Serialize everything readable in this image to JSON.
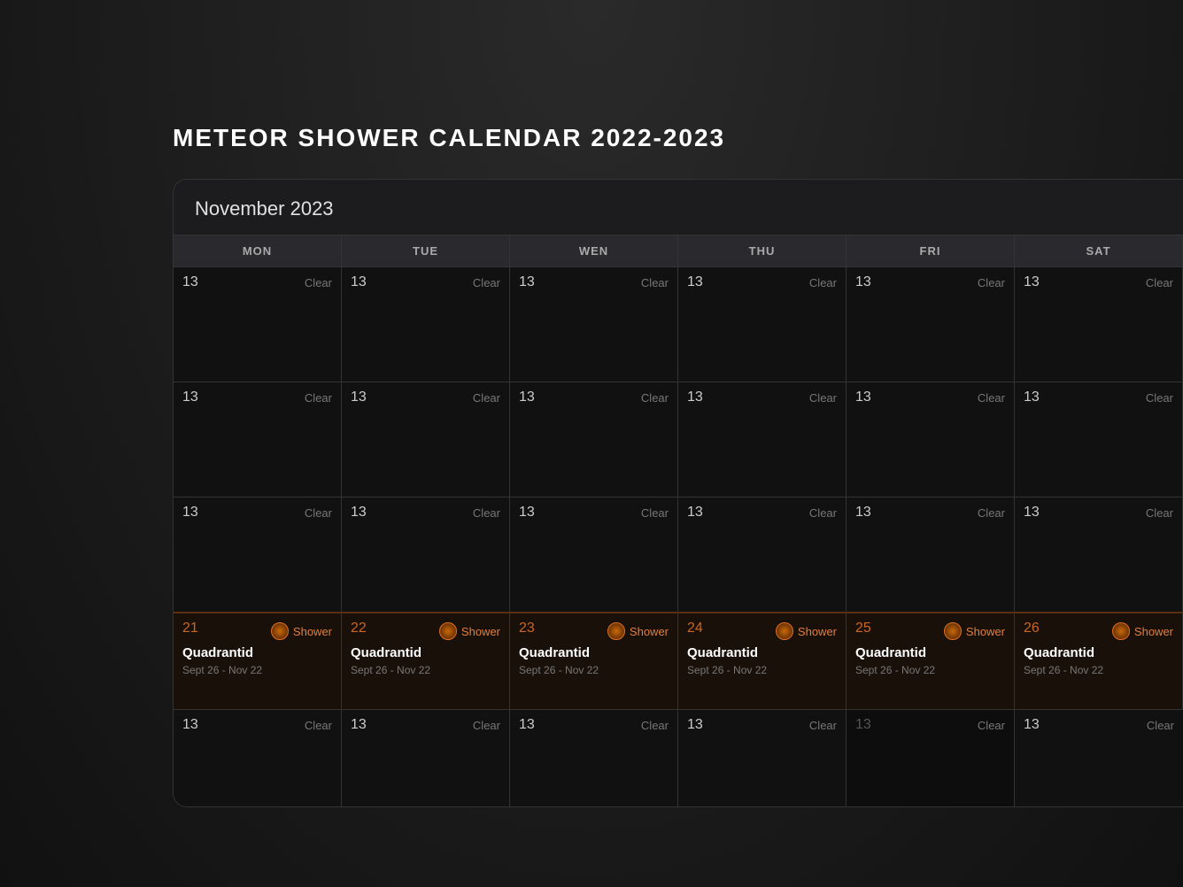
{
  "page": {
    "title": "METEOR SHOWER CALENDAR 2022-2023",
    "bg_color": "#1a1a1a"
  },
  "calendar": {
    "month_label": "November 2023",
    "days_of_week": [
      "MON",
      "TUE",
      "WEN",
      "THU",
      "FRI",
      "SAT"
    ],
    "rows": [
      {
        "type": "normal",
        "cells": [
          {
            "number": "13",
            "status": "Clear"
          },
          {
            "number": "13",
            "status": "Clear"
          },
          {
            "number": "13",
            "status": "Clear"
          },
          {
            "number": "13",
            "status": "Clear"
          },
          {
            "number": "13",
            "status": "Clear"
          },
          {
            "number": "13",
            "status": "Clear"
          }
        ]
      },
      {
        "type": "normal",
        "cells": [
          {
            "number": "13",
            "status": "Clear"
          },
          {
            "number": "13",
            "status": "Clear"
          },
          {
            "number": "13",
            "status": "Clear"
          },
          {
            "number": "13",
            "status": "Clear"
          },
          {
            "number": "13",
            "status": "Clear"
          },
          {
            "number": "13",
            "status": "Clear"
          }
        ]
      },
      {
        "type": "normal",
        "cells": [
          {
            "number": "13",
            "status": "Clear"
          },
          {
            "number": "13",
            "status": "Clear"
          },
          {
            "number": "13",
            "status": "Clear"
          },
          {
            "number": "13",
            "status": "Clear"
          },
          {
            "number": "13",
            "status": "Clear"
          },
          {
            "number": "13",
            "status": "Clear"
          }
        ]
      },
      {
        "type": "shower",
        "cells": [
          {
            "number": "21",
            "shower": "Shower",
            "event_name": "Quadrantid",
            "date_range": "Sept 26 - Nov 22"
          },
          {
            "number": "22",
            "shower": "Shower",
            "event_name": "Quadrantid",
            "date_range": "Sept 26 - Nov 22"
          },
          {
            "number": "23",
            "shower": "Shower",
            "event_name": "Quadrantid",
            "date_range": "Sept 26 - Nov 22"
          },
          {
            "number": "24",
            "shower": "Shower",
            "event_name": "Quadrantid",
            "date_range": "Sept 26 - Nov 22"
          },
          {
            "number": "25",
            "shower": "Shower",
            "event_name": "Quadrantid",
            "date_range": "Sept 26 - Nov 22"
          },
          {
            "number": "26",
            "shower": "Shower",
            "event_name": "Quadrantid",
            "date_range": "Sept 26 - Nov 22"
          }
        ]
      },
      {
        "type": "bottom",
        "cells": [
          {
            "number": "13",
            "status": "Clear"
          },
          {
            "number": "13",
            "status": "Clear"
          },
          {
            "number": "13",
            "status": "Clear"
          },
          {
            "number": "13",
            "status": "Clear"
          },
          {
            "number": "13",
            "status": "Clear",
            "dim": true
          },
          {
            "number": "13",
            "status": "Clear"
          }
        ]
      }
    ]
  }
}
